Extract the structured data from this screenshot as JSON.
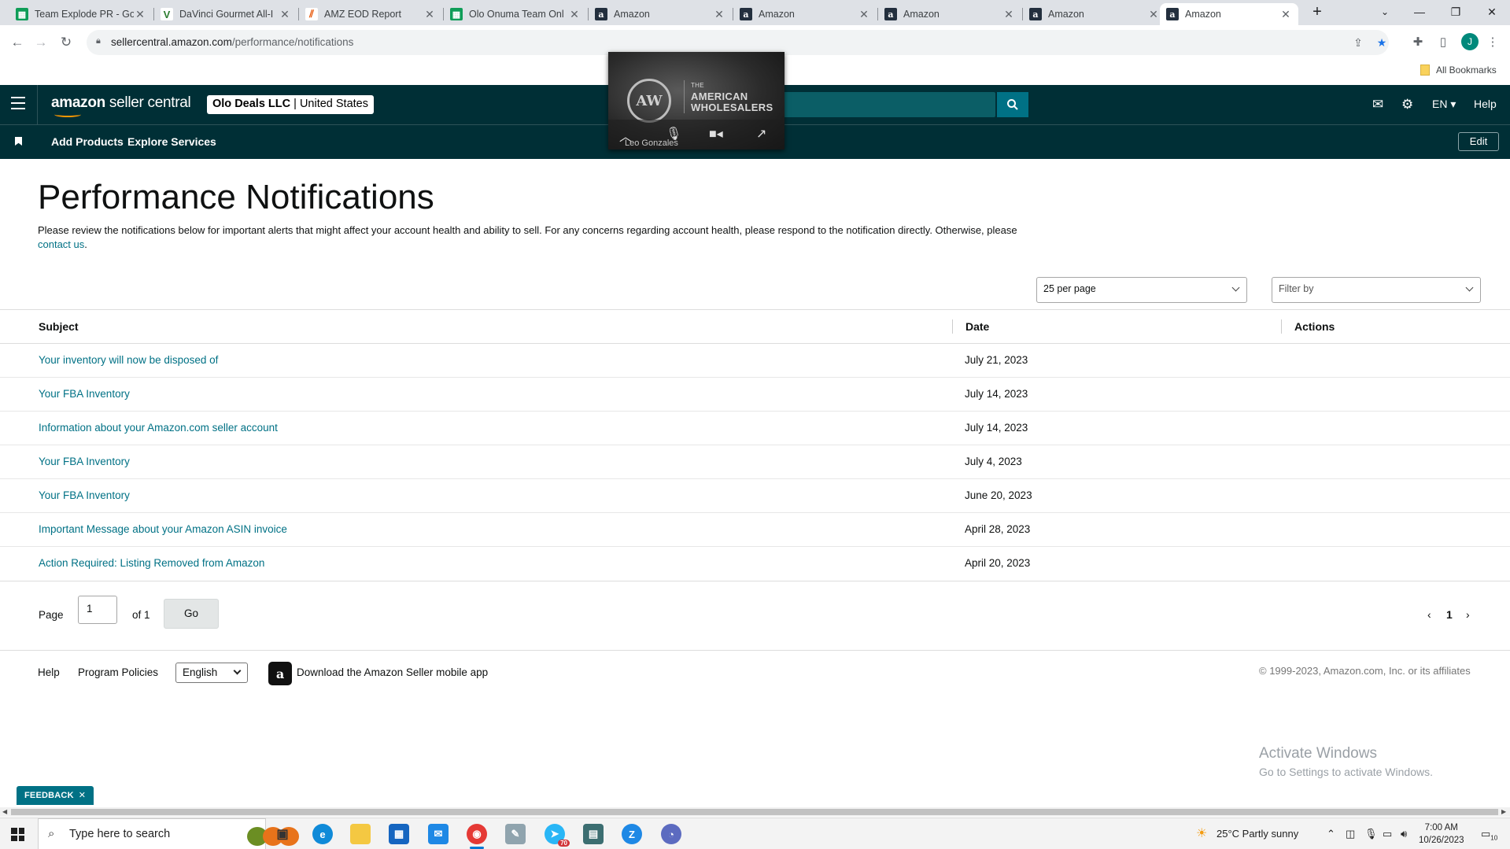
{
  "browser": {
    "tabs": [
      {
        "title": "Team Explode PR - Go",
        "icon": "google-sheets-icon"
      },
      {
        "title": "DaVinci Gourmet All-I",
        "icon": "davinci-icon"
      },
      {
        "title": "AMZ EOD Report",
        "icon": "report-icon"
      },
      {
        "title": "Olo Onuma Team Onl",
        "icon": "google-sheets-icon"
      },
      {
        "title": "Amazon",
        "icon": "amazon-icon"
      },
      {
        "title": "Amazon",
        "icon": "amazon-icon"
      },
      {
        "title": "Amazon",
        "icon": "amazon-icon"
      },
      {
        "title": "Amazon",
        "icon": "amazon-icon"
      },
      {
        "title": "Amazon",
        "icon": "amazon-icon",
        "active": true
      }
    ],
    "url_host": "sellercentral.amazon.com",
    "url_path": "/performance/notifications",
    "bookmarks_label": "All Bookmarks",
    "profile_initial": "J"
  },
  "header": {
    "logo_amazon": "amazon",
    "logo_suffix": " seller central",
    "account_name": "Olo Deals LLC",
    "account_region": "United States",
    "language": "EN",
    "help": "Help"
  },
  "nav": {
    "links": [
      "Add Products",
      "Explore Services"
    ],
    "edit": "Edit"
  },
  "video_overlay": {
    "brand_small": "THE",
    "brand_line1": "AMERICAN",
    "brand_line2": "WHOLESALERS",
    "participant": "Leo Gonzales"
  },
  "page": {
    "title": "Performance Notifications",
    "intro_text": "Please review the notifications below for important alerts that might affect your account health and ability to sell. For any concerns regarding account health, please respond to the notification directly. Otherwise, please ",
    "intro_link": "contact us",
    "intro_end": ".",
    "per_page": "25 per page",
    "filter_placeholder": "Filter by"
  },
  "table": {
    "headers": {
      "subject": "Subject",
      "date": "Date",
      "actions": "Actions"
    },
    "rows": [
      {
        "subject": "Your inventory will now be disposed of",
        "date": "July 21, 2023"
      },
      {
        "subject": "Your FBA Inventory",
        "date": "July 14, 2023"
      },
      {
        "subject": "Information about your Amazon.com seller account",
        "date": "July 14, 2023"
      },
      {
        "subject": "Your FBA Inventory",
        "date": "July 4, 2023"
      },
      {
        "subject": "Your FBA Inventory",
        "date": "June 20, 2023"
      },
      {
        "subject": "Important Message about your Amazon ASIN invoice",
        "date": "April 28, 2023"
      },
      {
        "subject": "Action Required: Listing Removed from Amazon",
        "date": "April 20, 2023"
      }
    ]
  },
  "pager": {
    "page_label": "Page",
    "page_value": "1",
    "of_label": "of 1",
    "go": "Go",
    "current": "1"
  },
  "footer": {
    "help": "Help",
    "policies": "Program Policies",
    "language": "English",
    "app_text": "Download the Amazon Seller mobile app",
    "copyright": "© 1999-2023, Amazon.com, Inc. or its affiliates"
  },
  "watermark": {
    "line1": "Activate Windows",
    "line2": "Go to Settings to activate Windows."
  },
  "feedback": "FEEDBACK",
  "taskbar": {
    "search_placeholder": "Type here to search",
    "weather": "25°C  Partly sunny",
    "time": "7:00 AM",
    "date": "10/26/2023",
    "notification_count": "10",
    "mail_badge": "70"
  },
  "colors": {
    "header_bg": "#002f36",
    "link": "#007185",
    "search_btn": "#007185"
  }
}
